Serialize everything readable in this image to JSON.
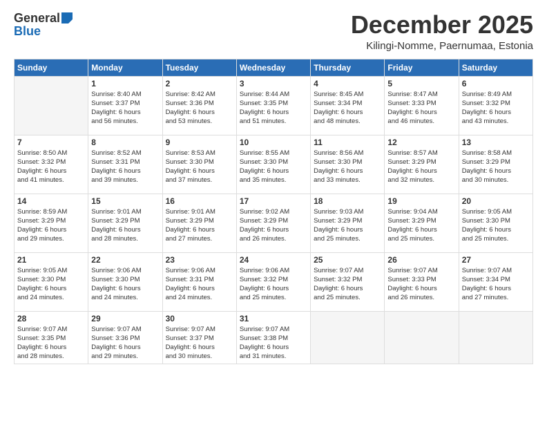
{
  "logo": {
    "general": "General",
    "blue": "Blue"
  },
  "title": "December 2025",
  "location": "Kilingi-Nomme, Paernumaa, Estonia",
  "weekdays": [
    "Sunday",
    "Monday",
    "Tuesday",
    "Wednesday",
    "Thursday",
    "Friday",
    "Saturday"
  ],
  "weeks": [
    [
      {
        "day": "",
        "info": ""
      },
      {
        "day": "1",
        "info": "Sunrise: 8:40 AM\nSunset: 3:37 PM\nDaylight: 6 hours\nand 56 minutes."
      },
      {
        "day": "2",
        "info": "Sunrise: 8:42 AM\nSunset: 3:36 PM\nDaylight: 6 hours\nand 53 minutes."
      },
      {
        "day": "3",
        "info": "Sunrise: 8:44 AM\nSunset: 3:35 PM\nDaylight: 6 hours\nand 51 minutes."
      },
      {
        "day": "4",
        "info": "Sunrise: 8:45 AM\nSunset: 3:34 PM\nDaylight: 6 hours\nand 48 minutes."
      },
      {
        "day": "5",
        "info": "Sunrise: 8:47 AM\nSunset: 3:33 PM\nDaylight: 6 hours\nand 46 minutes."
      },
      {
        "day": "6",
        "info": "Sunrise: 8:49 AM\nSunset: 3:32 PM\nDaylight: 6 hours\nand 43 minutes."
      }
    ],
    [
      {
        "day": "7",
        "info": "Sunrise: 8:50 AM\nSunset: 3:32 PM\nDaylight: 6 hours\nand 41 minutes."
      },
      {
        "day": "8",
        "info": "Sunrise: 8:52 AM\nSunset: 3:31 PM\nDaylight: 6 hours\nand 39 minutes."
      },
      {
        "day": "9",
        "info": "Sunrise: 8:53 AM\nSunset: 3:30 PM\nDaylight: 6 hours\nand 37 minutes."
      },
      {
        "day": "10",
        "info": "Sunrise: 8:55 AM\nSunset: 3:30 PM\nDaylight: 6 hours\nand 35 minutes."
      },
      {
        "day": "11",
        "info": "Sunrise: 8:56 AM\nSunset: 3:30 PM\nDaylight: 6 hours\nand 33 minutes."
      },
      {
        "day": "12",
        "info": "Sunrise: 8:57 AM\nSunset: 3:29 PM\nDaylight: 6 hours\nand 32 minutes."
      },
      {
        "day": "13",
        "info": "Sunrise: 8:58 AM\nSunset: 3:29 PM\nDaylight: 6 hours\nand 30 minutes."
      }
    ],
    [
      {
        "day": "14",
        "info": "Sunrise: 8:59 AM\nSunset: 3:29 PM\nDaylight: 6 hours\nand 29 minutes."
      },
      {
        "day": "15",
        "info": "Sunrise: 9:01 AM\nSunset: 3:29 PM\nDaylight: 6 hours\nand 28 minutes."
      },
      {
        "day": "16",
        "info": "Sunrise: 9:01 AM\nSunset: 3:29 PM\nDaylight: 6 hours\nand 27 minutes."
      },
      {
        "day": "17",
        "info": "Sunrise: 9:02 AM\nSunset: 3:29 PM\nDaylight: 6 hours\nand 26 minutes."
      },
      {
        "day": "18",
        "info": "Sunrise: 9:03 AM\nSunset: 3:29 PM\nDaylight: 6 hours\nand 25 minutes."
      },
      {
        "day": "19",
        "info": "Sunrise: 9:04 AM\nSunset: 3:29 PM\nDaylight: 6 hours\nand 25 minutes."
      },
      {
        "day": "20",
        "info": "Sunrise: 9:05 AM\nSunset: 3:30 PM\nDaylight: 6 hours\nand 25 minutes."
      }
    ],
    [
      {
        "day": "21",
        "info": "Sunrise: 9:05 AM\nSunset: 3:30 PM\nDaylight: 6 hours\nand 24 minutes."
      },
      {
        "day": "22",
        "info": "Sunrise: 9:06 AM\nSunset: 3:30 PM\nDaylight: 6 hours\nand 24 minutes."
      },
      {
        "day": "23",
        "info": "Sunrise: 9:06 AM\nSunset: 3:31 PM\nDaylight: 6 hours\nand 24 minutes."
      },
      {
        "day": "24",
        "info": "Sunrise: 9:06 AM\nSunset: 3:32 PM\nDaylight: 6 hours\nand 25 minutes."
      },
      {
        "day": "25",
        "info": "Sunrise: 9:07 AM\nSunset: 3:32 PM\nDaylight: 6 hours\nand 25 minutes."
      },
      {
        "day": "26",
        "info": "Sunrise: 9:07 AM\nSunset: 3:33 PM\nDaylight: 6 hours\nand 26 minutes."
      },
      {
        "day": "27",
        "info": "Sunrise: 9:07 AM\nSunset: 3:34 PM\nDaylight: 6 hours\nand 27 minutes."
      }
    ],
    [
      {
        "day": "28",
        "info": "Sunrise: 9:07 AM\nSunset: 3:35 PM\nDaylight: 6 hours\nand 28 minutes."
      },
      {
        "day": "29",
        "info": "Sunrise: 9:07 AM\nSunset: 3:36 PM\nDaylight: 6 hours\nand 29 minutes."
      },
      {
        "day": "30",
        "info": "Sunrise: 9:07 AM\nSunset: 3:37 PM\nDaylight: 6 hours\nand 30 minutes."
      },
      {
        "day": "31",
        "info": "Sunrise: 9:07 AM\nSunset: 3:38 PM\nDaylight: 6 hours\nand 31 minutes."
      },
      {
        "day": "",
        "info": ""
      },
      {
        "day": "",
        "info": ""
      },
      {
        "day": "",
        "info": ""
      }
    ]
  ]
}
